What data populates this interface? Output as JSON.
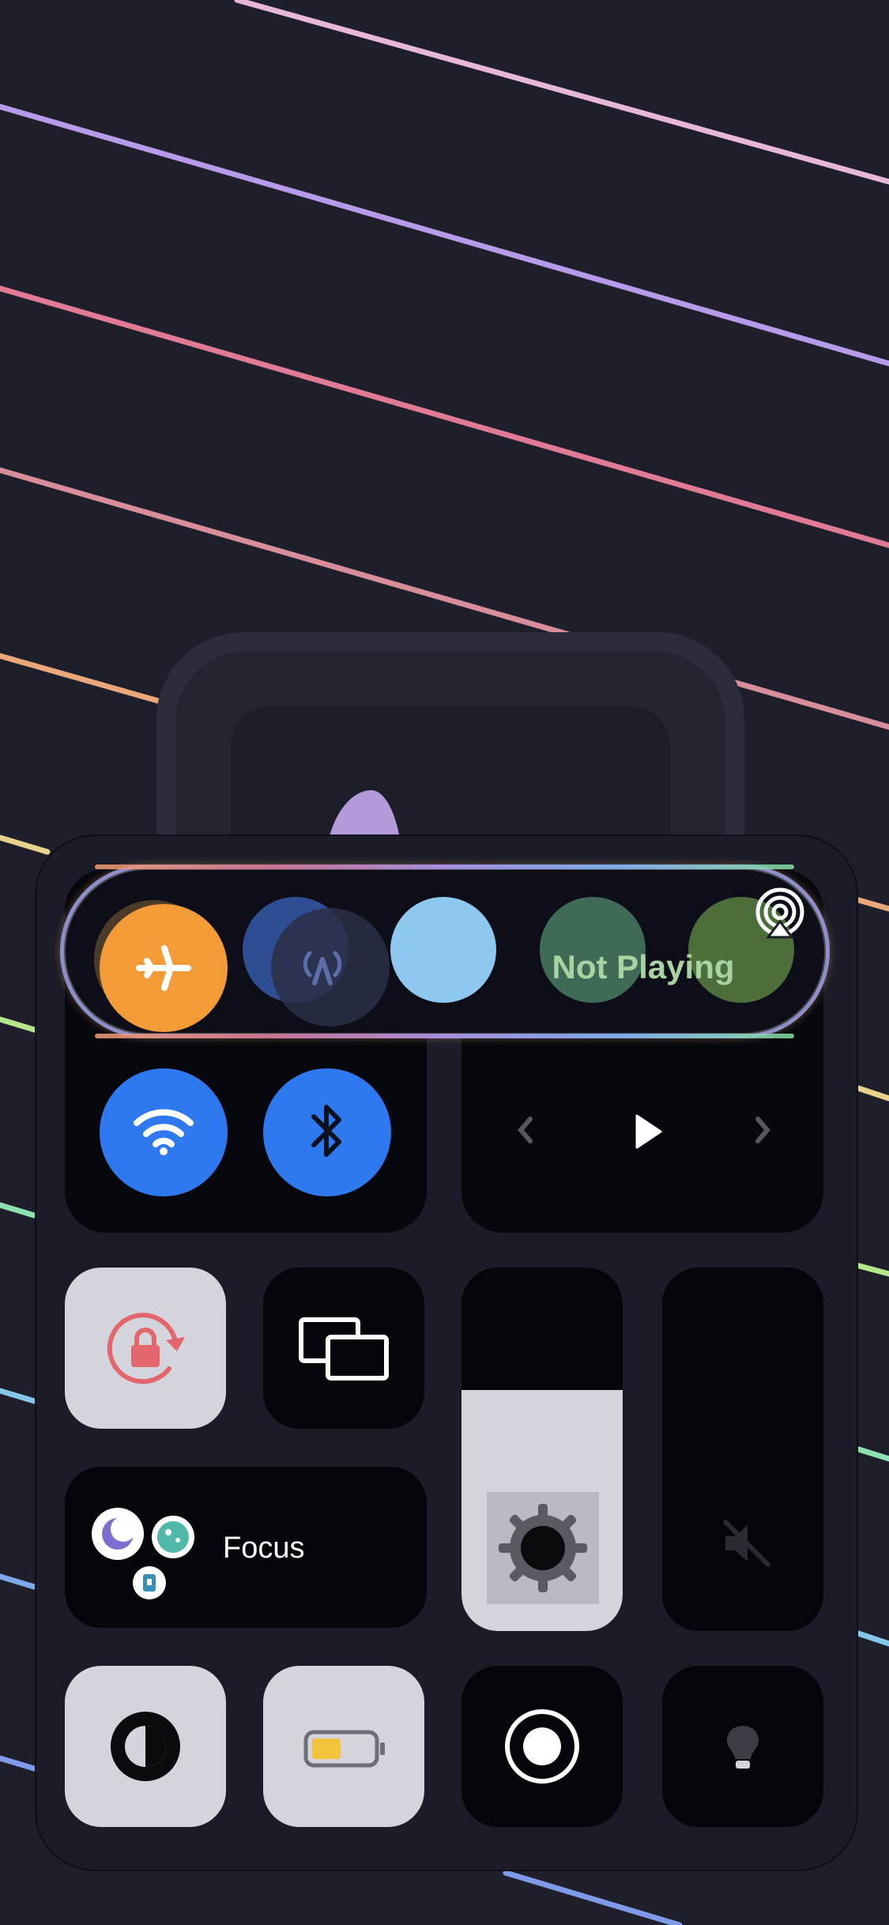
{
  "control_center": {
    "now_playing": {
      "label": "Not Playing"
    },
    "focus": {
      "label": "Focus"
    },
    "brightness": {
      "level": 0.65
    },
    "battery": {
      "level": 0.3
    }
  },
  "icons": [
    "airplane-icon",
    "cellular-icon",
    "wifi-icon",
    "bluetooth-icon",
    "airplay-icon",
    "previous-icon",
    "play-icon",
    "next-icon",
    "rotation-lock-icon",
    "screen-mirroring-icon",
    "brightness-icon",
    "mute-icon",
    "focus-moon-icon",
    "focus-dashboard-icon",
    "focus-badge-icon",
    "dark-mode-icon",
    "low-power-icon",
    "screen-record-icon",
    "flashlight-icon"
  ],
  "colors": {
    "airplane": "#f39b37",
    "wifi": "#2f79f0",
    "bluetooth": "#2f79f0",
    "rotation_lock": "#e2666c",
    "now_playing_text": "#a7d3a2",
    "background": "#1e1f2b"
  }
}
